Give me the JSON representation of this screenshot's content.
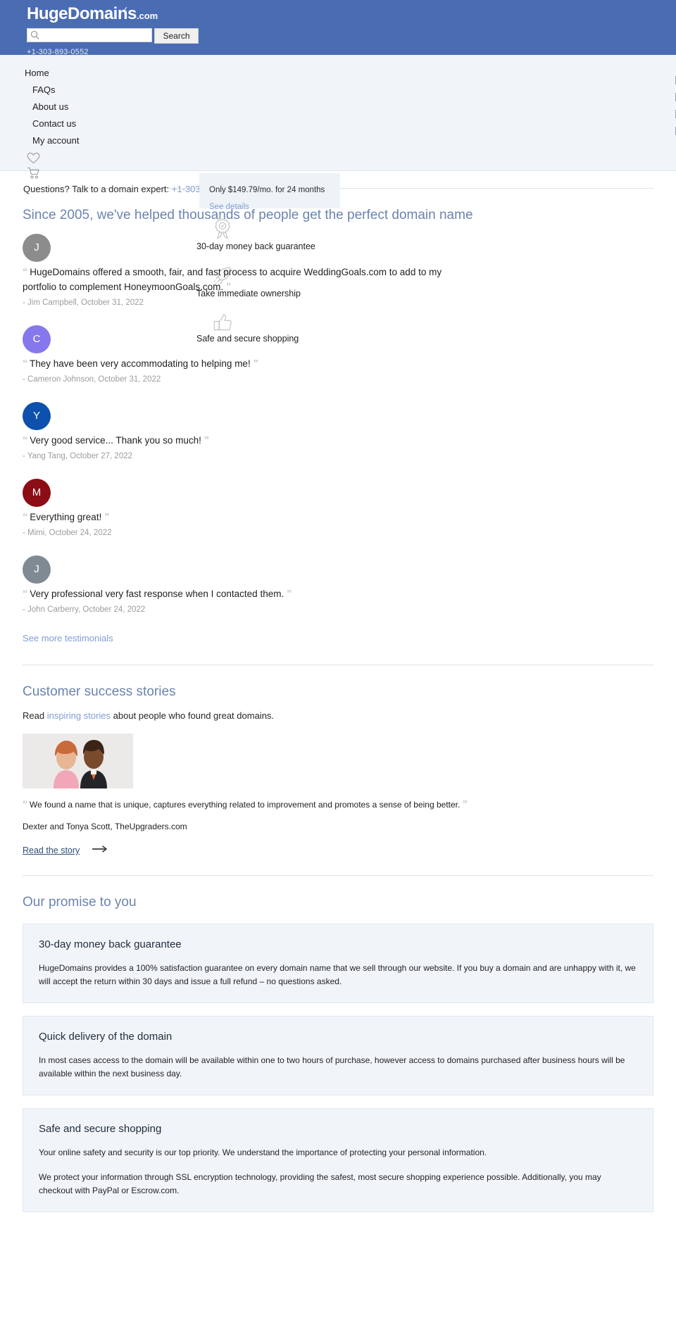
{
  "header": {
    "logo_main": "HugeDomains",
    "logo_suffix": ".com",
    "search_placeholder": "",
    "search_value": "",
    "search_button": "Search",
    "phone": "+1-303-893-0552"
  },
  "nav": {
    "items": [
      {
        "label": "Home",
        "level": 0
      },
      {
        "label": "FAQs",
        "level": 1
      },
      {
        "label": "About us",
        "level": 1
      },
      {
        "label": "Contact us",
        "level": 1
      },
      {
        "label": "My account",
        "level": 1
      }
    ],
    "wishlist_icon": "heart-icon",
    "cart_icon": "shopping-cart-icon"
  },
  "questions": {
    "text": "Questions? Talk to a domain expert:",
    "phone": "+1-303-893-0552"
  },
  "popup": {
    "price_text": "Only $149.79/mo. for 24 months",
    "link": "See details"
  },
  "testimonials_section": {
    "heading": "Since 2005, we've helped thousands of people get the perfect domain name",
    "see_more": "See more testimonials",
    "items": [
      {
        "initial": "J",
        "avatar_color": "#8c8c8c",
        "quote": "HugeDomains offered a smooth, fair, and fast process to acquire WeddingGoals.com to add to my portfolio to complement HoneymoonGoals.com.",
        "author": "- Jim Campbell, October 31, 2022"
      },
      {
        "initial": "C",
        "avatar_color": "#8577ec",
        "quote": "They have been very accommodating to helping me!",
        "author": "- Cameron Johnson, October 31, 2022"
      },
      {
        "initial": "Y",
        "avatar_color": "#0d50ad",
        "quote": "Very good service... Thank you so much!",
        "author": "- Yang Tang, October 27, 2022"
      },
      {
        "initial": "M",
        "avatar_color": "#8c0d15",
        "quote": "Everything great!",
        "author": "- Mimi, October 24, 2022"
      },
      {
        "initial": "J",
        "avatar_color": "#7f8a94",
        "quote": "Very professional very fast response when I contacted them.",
        "author": "- John Carberry, October 24, 2022"
      }
    ]
  },
  "badges": [
    {
      "icon": "award-ribbon-icon",
      "label": "30-day money back guarantee"
    },
    {
      "icon": "rocket-icon",
      "label": "Take immediate ownership"
    },
    {
      "icon": "thumbs-up-icon",
      "label": "Safe and secure shopping"
    }
  ],
  "success_stories": {
    "heading": "Customer success stories",
    "intro_prefix": "Read ",
    "intro_link": "inspiring stories",
    "intro_suffix": " about people who found great domains.",
    "quote": "We found a name that is unique, captures everything related to improvement and promotes a sense of being better.",
    "attribution": "Dexter and Tonya Scott, TheUpgraders.com",
    "read_link": "Read the story",
    "arrow_icon": "arrow-right-icon"
  },
  "promise": {
    "heading": "Our promise to you",
    "cards": [
      {
        "title": "30-day money back guarantee",
        "paragraphs": [
          "HugeDomains provides a 100% satisfaction guarantee on every domain name that we sell through our website. If you buy a domain and are unhappy with it, we will accept the return within 30 days and issue a full refund – no questions asked."
        ]
      },
      {
        "title": "Quick delivery of the domain",
        "paragraphs": [
          "In most cases access to the domain will be available within one to two hours of purchase, however access to domains purchased after business hours will be available within the next business day."
        ]
      },
      {
        "title": "Safe and secure shopping",
        "paragraphs": [
          "Your online safety and security is our top priority. We understand the importance of protecting your personal information.",
          "We protect your information through SSL encryption technology, providing the safest, most secure shopping experience possible. Additionally, you may checkout with PayPal or Escrow.com."
        ]
      }
    ]
  },
  "colors": {
    "brand_blue": "#4a6cb3",
    "nav_bg": "#f1f4f8",
    "heading_blue": "#6b84ae",
    "link_blue": "#7f9fd4",
    "card_bg": "#f1f5f9"
  }
}
